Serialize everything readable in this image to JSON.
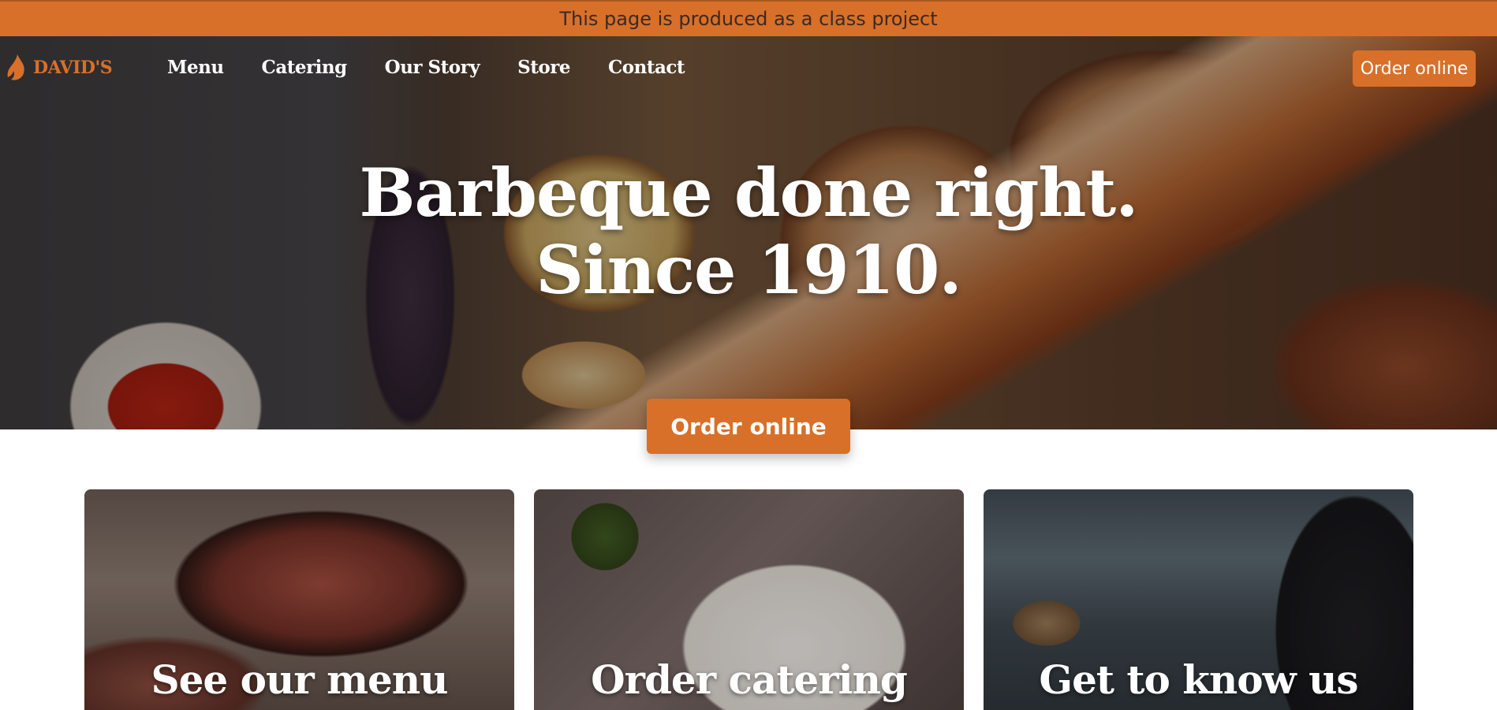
{
  "banner": {
    "text": "This page is produced as a class project"
  },
  "brand": {
    "logo_text": "DAVID'S",
    "accent_color": "#d8702a"
  },
  "nav": {
    "links": [
      "Menu",
      "Catering",
      "Our Story",
      "Store",
      "Contact"
    ],
    "order_button": "Order online"
  },
  "hero": {
    "title_line1": "Barbeque done right.",
    "title_line2": "Since 1910.",
    "cta_button": "Order online"
  },
  "cards": [
    {
      "title": "See our menu"
    },
    {
      "title": "Order catering"
    },
    {
      "title": "Get to know us"
    }
  ]
}
